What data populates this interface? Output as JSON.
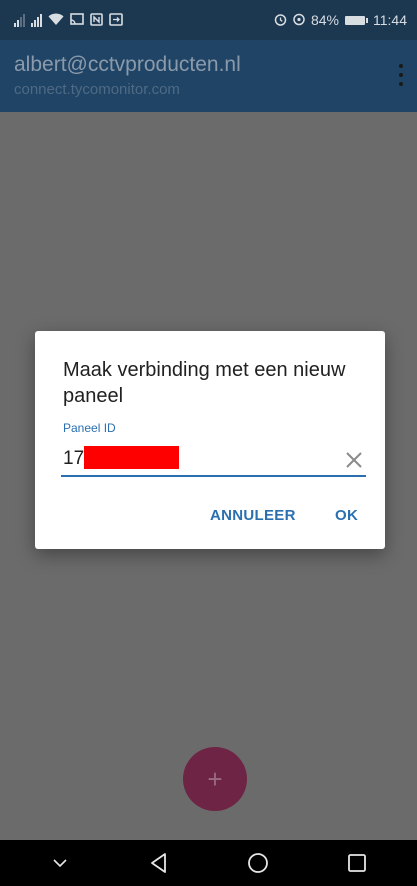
{
  "status_bar": {
    "time": "11:44",
    "battery_percent": "84%",
    "icons": [
      "signal-weak-icon",
      "signal-icon",
      "wifi-icon",
      "cast-icon",
      "nfc-icon",
      "screen-mirror-icon",
      "alarm-icon",
      "location-icon",
      "battery-icon"
    ]
  },
  "app_bar": {
    "title": "albert@cctvproducten.nl",
    "subtitle": "connect.tycomonitor.com",
    "menu_icon": "overflow-menu-icon"
  },
  "dialog": {
    "title": "Maak verbinding met een nieuw paneel",
    "field_label": "Paneel ID",
    "field_value": "17",
    "clear_icon": "clear-icon",
    "cancel_label": "ANNULEER",
    "ok_label": "OK"
  },
  "fab": {
    "label": "+"
  },
  "colors": {
    "status_bar": "#1c3750",
    "app_bar": "#1f4465",
    "accent": "#2a6fb0",
    "fab": "#6e2445",
    "redaction": "#ff0000"
  }
}
